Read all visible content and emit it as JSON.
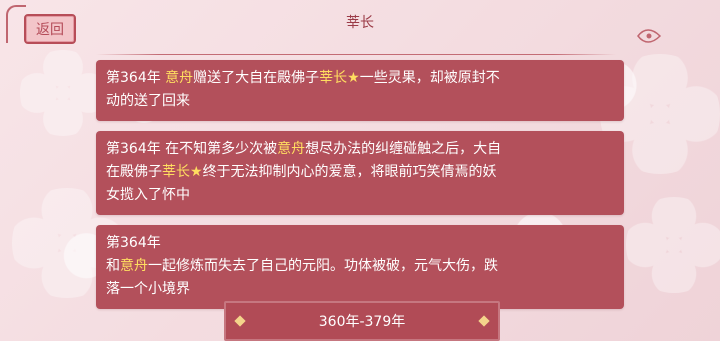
{
  "header": {
    "back_label": "返回",
    "title": "莘长"
  },
  "entries": [
    {
      "lines": [
        [
          {
            "text": "第364年 ",
            "color": "white"
          },
          {
            "text": "意舟",
            "color": "yellow"
          },
          {
            "text": "赠送了大自在殿佛子",
            "color": "white"
          },
          {
            "text": "莘长★",
            "color": "yellow"
          },
          {
            "text": "一些灵果，却被原封不",
            "color": "white"
          }
        ],
        [
          {
            "text": "动的送了回来",
            "color": "white"
          }
        ]
      ]
    },
    {
      "lines": [
        [
          {
            "text": "第364年 在不知第多少次被",
            "color": "white"
          },
          {
            "text": "意舟",
            "color": "yellow"
          },
          {
            "text": "想尽办法的纠缠碰触之后，大自",
            "color": "white"
          }
        ],
        [
          {
            "text": "在殿佛子",
            "color": "white"
          },
          {
            "text": "莘长★",
            "color": "yellow"
          },
          {
            "text": "终于无法抑制内心的爱意，将眼前巧笑倩焉的妖",
            "color": "white"
          }
        ],
        [
          {
            "text": "女揽入了怀中",
            "color": "white"
          }
        ]
      ]
    },
    {
      "lines": [
        [
          {
            "text": "第364年",
            "color": "white"
          }
        ],
        [
          {
            "text": "和",
            "color": "white"
          },
          {
            "text": "意舟",
            "color": "yellow"
          },
          {
            "text": "一起修炼而失去了自己的元阳。功体被破，元气大伤，跌",
            "color": "white"
          }
        ],
        [
          {
            "text": "落一个小境界",
            "color": "white"
          }
        ]
      ]
    }
  ],
  "footer": {
    "range_label": "360年-379年"
  }
}
